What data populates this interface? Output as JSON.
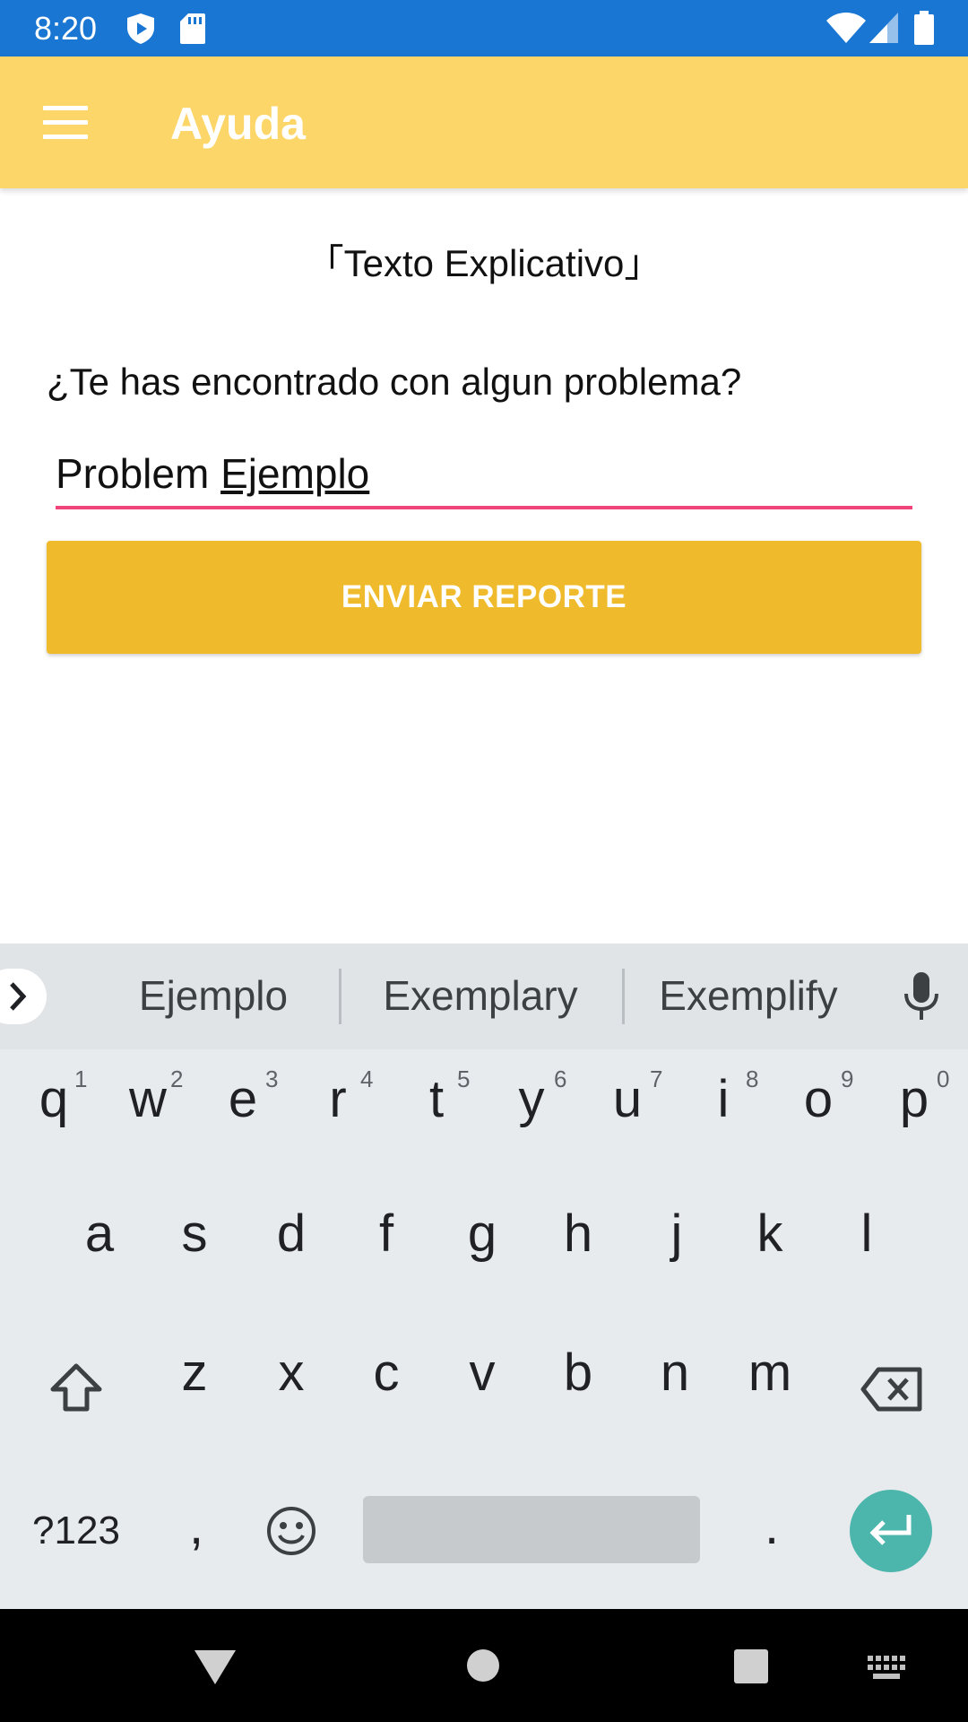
{
  "status_bar": {
    "time": "8:20",
    "icons": [
      "shield-play-icon",
      "sd-card-icon",
      "wifi-icon",
      "signal-icon",
      "battery-icon"
    ]
  },
  "app_bar": {
    "menu_icon": "menu-icon",
    "title": "Ayuda"
  },
  "content": {
    "explain_text": "「Texto Explicativo」",
    "question": "¿Te has encontrado con algun problema?",
    "problem_input": {
      "value_word1": "Problem ",
      "value_word2": "Ejemplo"
    },
    "send_button": "ENVIAR REPORTE"
  },
  "keyboard": {
    "suggestions": [
      "Ejemplo",
      "Exemplary",
      "Exemplify"
    ],
    "row1": [
      {
        "key": "q",
        "hint": "1"
      },
      {
        "key": "w",
        "hint": "2"
      },
      {
        "key": "e",
        "hint": "3"
      },
      {
        "key": "r",
        "hint": "4"
      },
      {
        "key": "t",
        "hint": "5"
      },
      {
        "key": "y",
        "hint": "6"
      },
      {
        "key": "u",
        "hint": "7"
      },
      {
        "key": "i",
        "hint": "8"
      },
      {
        "key": "o",
        "hint": "9"
      },
      {
        "key": "p",
        "hint": "0"
      }
    ],
    "row2": [
      "a",
      "s",
      "d",
      "f",
      "g",
      "h",
      "j",
      "k",
      "l"
    ],
    "row3": [
      "z",
      "x",
      "c",
      "v",
      "b",
      "n",
      "m"
    ],
    "symbols_key": "?123",
    "comma_key": ",",
    "period_key": "."
  },
  "colors": {
    "status_bar": "#1976d2",
    "app_bar": "#fdd66a",
    "button": "#efbb2c",
    "input_underline": "#f0457a",
    "enter_key": "#4db6ac"
  }
}
